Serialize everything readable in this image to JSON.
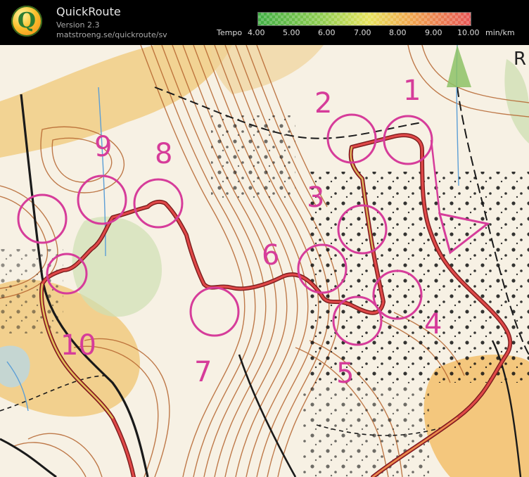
{
  "app": {
    "title": "QuickRoute",
    "version": "Version 2.3",
    "url": "matstroeng.se/quickroute/sv",
    "logo_letter": "Q"
  },
  "tempo_legend": {
    "label": "Tempo",
    "ticks": [
      "4.00",
      "5.00",
      "6.00",
      "7.00",
      "8.00",
      "9.00",
      "10.00"
    ],
    "unit": "min/km",
    "colors": [
      "#3fae43",
      "#8fcc4f",
      "#e7e35c",
      "#f0a54c",
      "#e65454"
    ]
  },
  "map": {
    "edge_letter": "R",
    "control_color": "#d63c9a",
    "route_color": "#c62828",
    "controls": [
      {
        "number": "1"
      },
      {
        "number": "2"
      },
      {
        "number": "3"
      },
      {
        "number": "4"
      },
      {
        "number": "5"
      },
      {
        "number": "6"
      },
      {
        "number": "7"
      },
      {
        "number": "8"
      },
      {
        "number": "9"
      },
      {
        "number": "10"
      }
    ]
  }
}
